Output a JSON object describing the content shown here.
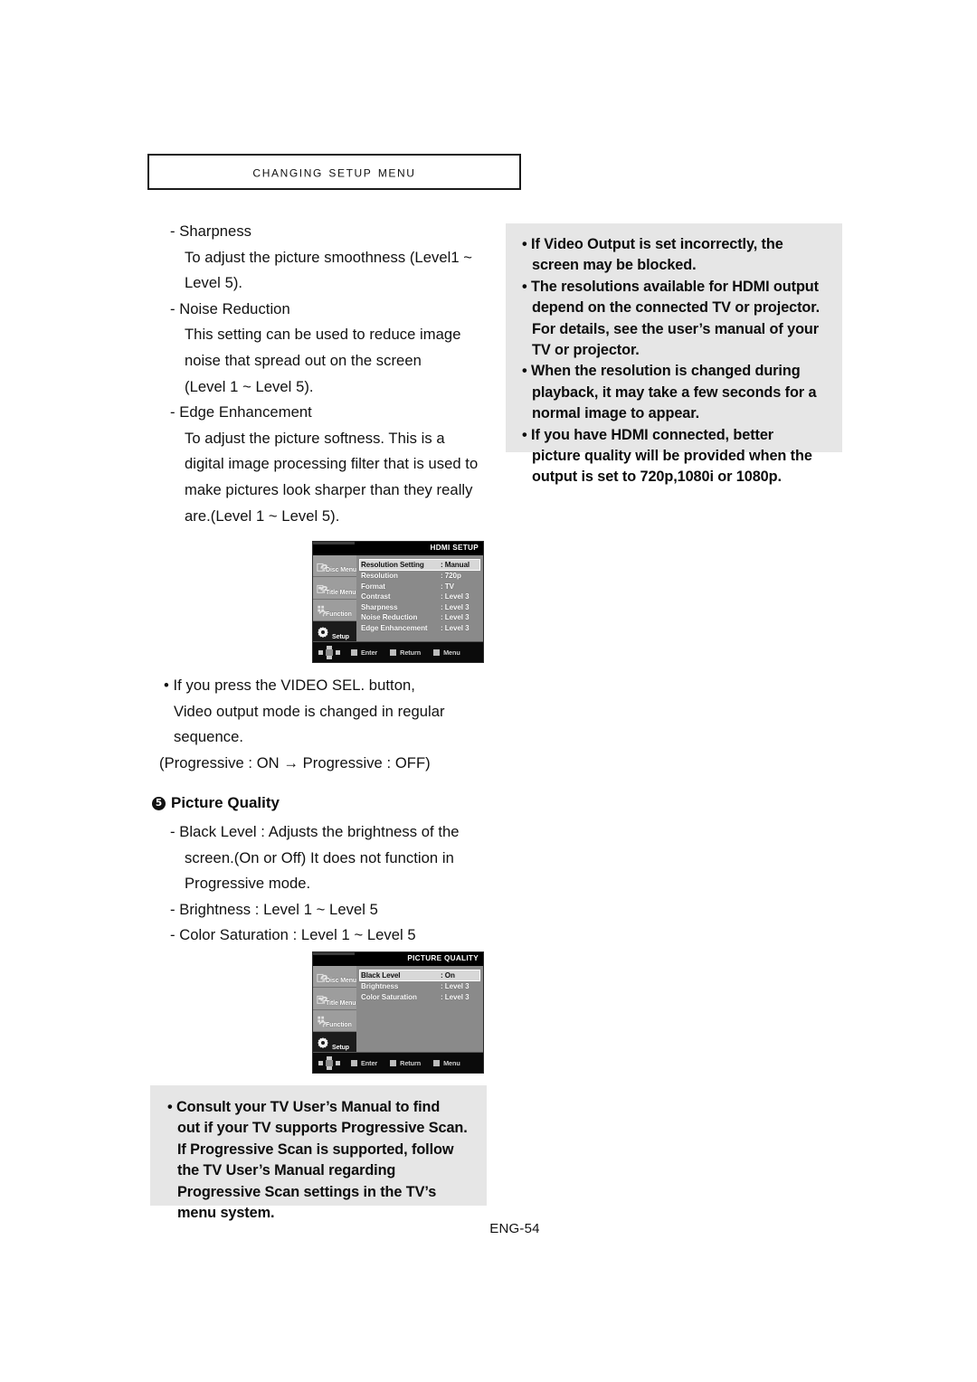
{
  "header": {
    "title": "Changing Setup menu"
  },
  "left_column": {
    "items": [
      {
        "kind": "dash",
        "lines": [
          "- Sharpness"
        ]
      },
      {
        "kind": "body",
        "lines": [
          "To adjust the picture smoothness (Level1 ~",
          "Level 5)."
        ]
      },
      {
        "kind": "dash",
        "lines": [
          "- Noise Reduction"
        ]
      },
      {
        "kind": "body",
        "lines": [
          "This setting can be used to reduce image",
          "noise that spread out on the screen",
          "(Level 1 ~ Level 5)."
        ]
      },
      {
        "kind": "dash",
        "lines": [
          "- Edge Enhancement"
        ]
      },
      {
        "kind": "body",
        "lines": [
          "To adjust the picture softness. This is a",
          "digital image processing filter that is used to",
          "make pictures look sharper than they really",
          "are.(Level 1 ~ Level 5)."
        ]
      }
    ],
    "l1": "- Sharpness",
    "l2": "To adjust the picture smoothness (Level1 ~",
    "l3": "Level 5).",
    "l4": "- Noise Reduction",
    "l5": "This setting can be used to reduce image",
    "l6": "noise that spread out on the screen",
    "l7": "(Level 1 ~ Level 5).",
    "l8": "- Edge Enhancement",
    "l9": "To adjust the picture softness. This is a",
    "l10": "digital image processing filter that is used to",
    "l11": "make pictures look sharper than they really",
    "l12": "are.(Level 1 ~ Level 5)."
  },
  "note_right": {
    "lines": [
      "• If Video Output is set incorrectly, the",
      "screen may be blocked.",
      "• The resolutions available for HDMI output",
      "depend on the connected TV or projector.",
      "For details, see the user’s manual of your",
      "TV or projector.",
      "• When the resolution is changed during",
      "playback, it may take a few seconds for a",
      "normal image to appear.",
      "• If you have HDMI connected, better",
      "picture quality will be provided when the",
      "output is set to 720p,1080i or 1080p."
    ],
    "n1": "• If Video Output is set incorrectly, the",
    "n2": "screen may be blocked.",
    "n3": "• The resolutions available for HDMI output",
    "n4": "depend on the connected TV or projector.",
    "n5": "For details, see the user’s manual of your",
    "n6": "TV or projector.",
    "n7": "• When the resolution is changed during",
    "n8": "playback, it may take a few seconds for a",
    "n9": "normal image to appear.",
    "n10": "• If you have HDMI connected, better",
    "n11": "picture quality will be provided when the",
    "n12": "output is set to 720p,1080i or 1080p."
  },
  "osd_hdmi": {
    "title": "HDMI SETUP",
    "sidebar": [
      {
        "label": "Disc Menu",
        "icon": "disc-menu-icon",
        "active": false
      },
      {
        "label": "Title Menu",
        "icon": "title-menu-icon",
        "active": false
      },
      {
        "label": "Function",
        "icon": "function-icon",
        "active": false
      },
      {
        "label": "Setup",
        "icon": "gear-icon",
        "active": true
      }
    ],
    "rows": [
      {
        "key": "Resolution Setting",
        "value": ": Manual",
        "selected": true
      },
      {
        "key": "Resolution",
        "value": ": 720p",
        "selected": false
      },
      {
        "key": "Format",
        "value": ": TV",
        "selected": false
      },
      {
        "key": "Contrast",
        "value": ": Level 3",
        "selected": false
      },
      {
        "key": "Sharpness",
        "value": ": Level 3",
        "selected": false
      },
      {
        "key": "Noise Reduction",
        "value": ": Level 3",
        "selected": false
      },
      {
        "key": "Edge Enhancement",
        "value": ": Level 3",
        "selected": false
      }
    ],
    "footer": [
      {
        "label": "Enter",
        "icon": "button-square-icon"
      },
      {
        "label": "Return",
        "icon": "button-square-icon"
      },
      {
        "label": "Menu",
        "icon": "button-square-icon"
      }
    ]
  },
  "mid_block": {
    "lines": [
      "• If you press the VIDEO SEL. button,",
      "Video output mode is changed in regular",
      "sequence."
    ],
    "m1": "• If you press the VIDEO SEL. button,",
    "m2": "Video output mode is changed in regular",
    "m3": "sequence.",
    "m4": "(Progressive : ON → Progressive : OFF)"
  },
  "section": {
    "number": "5",
    "title": "Picture Quality",
    "lines": [
      "- Black Level : Adjusts the brightness of the",
      "screen.(On or Off) It does not function in",
      "Progressive mode.",
      "- Brightness : Level 1 ~ Level 5",
      "- Color Saturation : Level 1 ~ Level 5"
    ],
    "s1": "- Black Level : Adjusts the brightness of the",
    "s2": "screen.(On or Off) It does not function in",
    "s3": "Progressive mode.",
    "s4": "- Brightness : Level 1 ~ Level 5",
    "s5": "- Color Saturation : Level 1 ~ Level 5"
  },
  "osd_pq": {
    "title": "PICTURE QUALITY",
    "sidebar": [
      {
        "label": "Disc Menu",
        "icon": "disc-menu-icon",
        "active": false
      },
      {
        "label": "Title Menu",
        "icon": "title-menu-icon",
        "active": false
      },
      {
        "label": "Function",
        "icon": "function-icon",
        "active": false
      },
      {
        "label": "Setup",
        "icon": "gear-icon",
        "active": true
      }
    ],
    "rows": [
      {
        "key": "Black Level",
        "value": ": On",
        "selected": true
      },
      {
        "key": "Brightness",
        "value": ": Level 3",
        "selected": false
      },
      {
        "key": "Color Saturation",
        "value": ": Level 3",
        "selected": false
      }
    ],
    "footer": [
      {
        "label": "Enter",
        "icon": "button-square-icon"
      },
      {
        "label": "Return",
        "icon": "button-square-icon"
      },
      {
        "label": "Menu",
        "icon": "button-square-icon"
      }
    ]
  },
  "note_bottom": {
    "lines": [
      "• Consult your TV User’s Manual to find",
      "out if your TV supports Progressive Scan.",
      "If Progressive Scan is supported, follow",
      "the TV User’s Manual regarding",
      "Progressive Scan settings in the TV’s",
      "menu system."
    ],
    "b1": "• Consult your TV User’s Manual to find",
    "b2": "out if your TV supports Progressive Scan.",
    "b3": "If Progressive Scan is supported, follow",
    "b4": "the TV User’s Manual regarding",
    "b5": "Progressive Scan settings in the TV’s",
    "b6": "menu system."
  },
  "footer": {
    "page_number": "ENG-54"
  },
  "colors": {
    "note_bg": "#e6e6e6",
    "osd_bg": "#8a8a8a",
    "osd_sidebar": "#9d9d9d",
    "osd_selected": "#d8d8d8",
    "osd_black": "#000000",
    "text": "#111111"
  }
}
